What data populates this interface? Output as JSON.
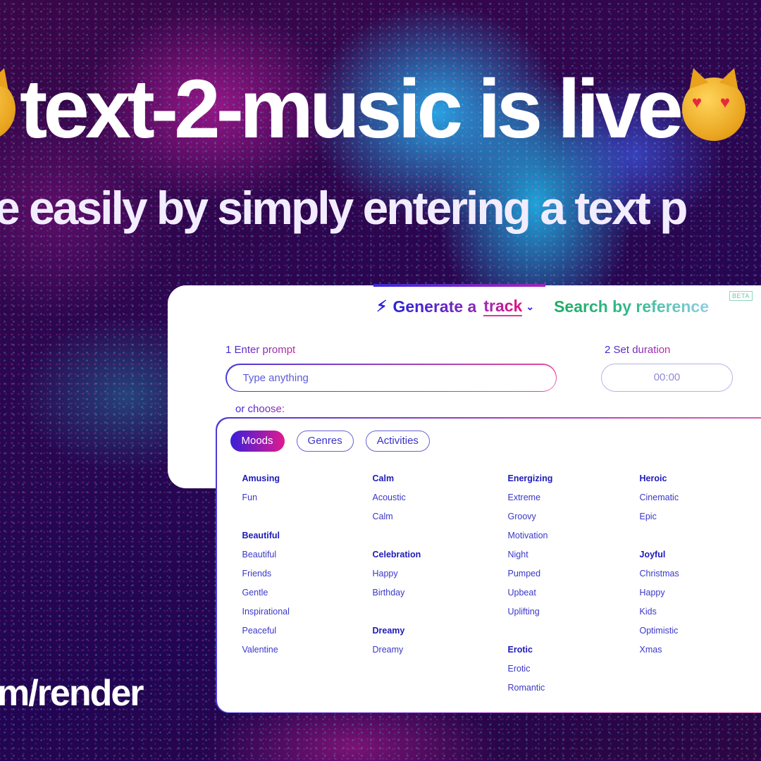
{
  "hero": {
    "headline": "text-2-music is live",
    "left_emoji": "cat-emoji",
    "right_emoji": "heart-eyes-cat-emoji",
    "subline": "e easily by simply entering a text p",
    "url_fragment": "m/render"
  },
  "generator": {
    "mode_icon": "lightning-bolt-icon",
    "generate_prefix": "Generate a",
    "generate_type": "track",
    "search_label": "Search by reference",
    "beta_badge": "BETA",
    "step1_label": "1 Enter prompt",
    "prompt_placeholder": "Type anything",
    "prompt_value": "",
    "step2_label": "2 Set duration",
    "duration_value": "00:00",
    "or_choose": "or choose:"
  },
  "picker": {
    "tabs": [
      {
        "label": "Moods",
        "active": true
      },
      {
        "label": "Genres",
        "active": false
      },
      {
        "label": "Activities",
        "active": false
      }
    ],
    "columns": [
      [
        {
          "title": "Amusing",
          "items": [
            "Fun"
          ]
        },
        {
          "title": "Beautiful",
          "items": [
            "Beautiful",
            "Friends",
            "Gentle",
            "Inspirational",
            "Peaceful",
            "Valentine"
          ]
        }
      ],
      [
        {
          "title": "Calm",
          "items": [
            "Acoustic",
            "Calm"
          ]
        },
        {
          "title": "Celebration",
          "items": [
            "Happy",
            "Birthday"
          ]
        },
        {
          "title": "Dreamy",
          "items": [
            "Dreamy"
          ]
        }
      ],
      [
        {
          "title": "Energizing",
          "items": [
            "Extreme",
            "Groovy",
            "Motivation",
            "Night",
            "Pumped",
            "Upbeat",
            "Uplifting"
          ]
        },
        {
          "title": "Erotic",
          "items": [
            "Erotic",
            "Romantic"
          ]
        }
      ],
      [
        {
          "title": "Heroic",
          "items": [
            "Cinematic",
            "Epic"
          ]
        },
        {
          "title": "Joyful",
          "items": [
            "Christmas",
            "Happy",
            "Kids",
            "Optimistic",
            "Xmas"
          ]
        }
      ]
    ]
  },
  "colors": {
    "primary_blue": "#2a25d6",
    "accent_pink": "#e0157f",
    "reference_green": "#1faa64",
    "background_purple": "#2a0650"
  }
}
